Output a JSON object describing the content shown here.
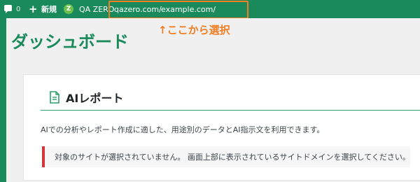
{
  "adminbar": {
    "comment_count": "0",
    "new_label": "新規",
    "qa_badge": "Z",
    "qa_label": "QA ZERO",
    "site_url_1": "qazero.com/",
    "site_url_2": "example.com/"
  },
  "annotation": "↑ここから選択",
  "page": {
    "title": "ダッシュボード"
  },
  "card": {
    "title": "AIレポート",
    "description": "AIでの分析やレポート作成に適した、用途別のデータとAI指示文を利用できます。",
    "notice": "対象のサイトが選択されていません。 画面上部に表示されているサイトドメインを選択してください。"
  },
  "colors": {
    "brand_green": "#1a8a5c",
    "annotation_orange": "#f07f23",
    "notice_red": "#d63638"
  }
}
